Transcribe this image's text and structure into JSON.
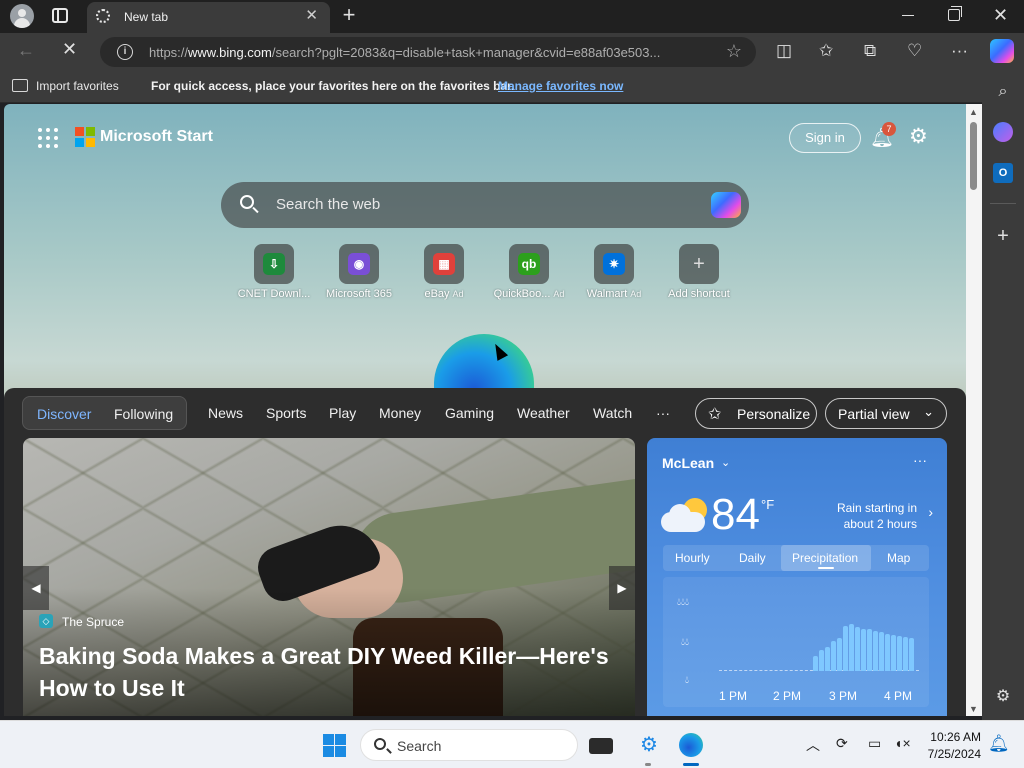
{
  "browser": {
    "tab_title": "New tab",
    "tab_close_glyph": "✕",
    "new_tab_glyph": "+",
    "url_prefix": "https://",
    "url_host": "www.bing.com",
    "url_rest": "/search?pglt=2083&q=disable+task+manager&cvid=e88af03e503...",
    "info_glyph": "i"
  },
  "favorites_bar": {
    "import_label": "Import favorites",
    "message": "For quick access, place your favorites here on the favorites bar.",
    "manage_link": "Manage favorites now"
  },
  "newtab": {
    "brand_title": "Microsoft Start",
    "sign_in_label": "Sign in",
    "notification_count": "7",
    "search_placeholder": "Search the web",
    "shortcuts": [
      {
        "label": "CNET Downl...",
        "ad": "",
        "icon": "cnet-download-icon",
        "color": "#1e8a3c",
        "glyph": "⇩"
      },
      {
        "label": "Microsoft 365",
        "ad": "",
        "icon": "microsoft-365-icon",
        "color": "#7a4fd6",
        "glyph": "◉"
      },
      {
        "label": "eBay",
        "ad": "Ad",
        "icon": "ebay-icon",
        "color": "#e0413b",
        "glyph": "▦"
      },
      {
        "label": "QuickBoo...",
        "ad": "Ad",
        "icon": "quickbooks-icon",
        "color": "#2ca01c",
        "glyph": "qb"
      },
      {
        "label": "Walmart",
        "ad": "Ad",
        "icon": "walmart-icon",
        "color": "#0071dc",
        "glyph": "✷"
      },
      {
        "label": "Add shortcut",
        "ad": "",
        "icon": "plus-icon",
        "color": "transparent",
        "glyph": "+"
      }
    ]
  },
  "feed": {
    "tab_discover": "Discover",
    "tab_following": "Following",
    "nav": [
      "News",
      "Sports",
      "Play",
      "Money",
      "Gaming",
      "Weather",
      "Watch",
      "···"
    ],
    "personalize_label": "Personalize",
    "partial_view_label": "Partial view",
    "hero": {
      "source": "The Spruce",
      "title": "Baking Soda Makes a Great DIY Weed Killer—Here's How to Use It"
    }
  },
  "weather": {
    "location": "McLean",
    "temperature": "84",
    "unit": "°F",
    "rain_note": "Rain starting in about 2 hours",
    "tabs": [
      "Hourly",
      "Daily",
      "Precipitation",
      "Map"
    ],
    "active_tab": "Precipitation",
    "time_labels": [
      "1 PM",
      "2 PM",
      "3 PM",
      "4 PM"
    ],
    "precip_levels": [
      0.25,
      0.35,
      0.4,
      0.5,
      0.55,
      0.75,
      0.78,
      0.74,
      0.7,
      0.7,
      0.67,
      0.65,
      0.62,
      0.6,
      0.58,
      0.56,
      0.55
    ]
  },
  "taskbar": {
    "search_label": "Search",
    "time": "10:26 AM",
    "date": "7/25/2024"
  }
}
